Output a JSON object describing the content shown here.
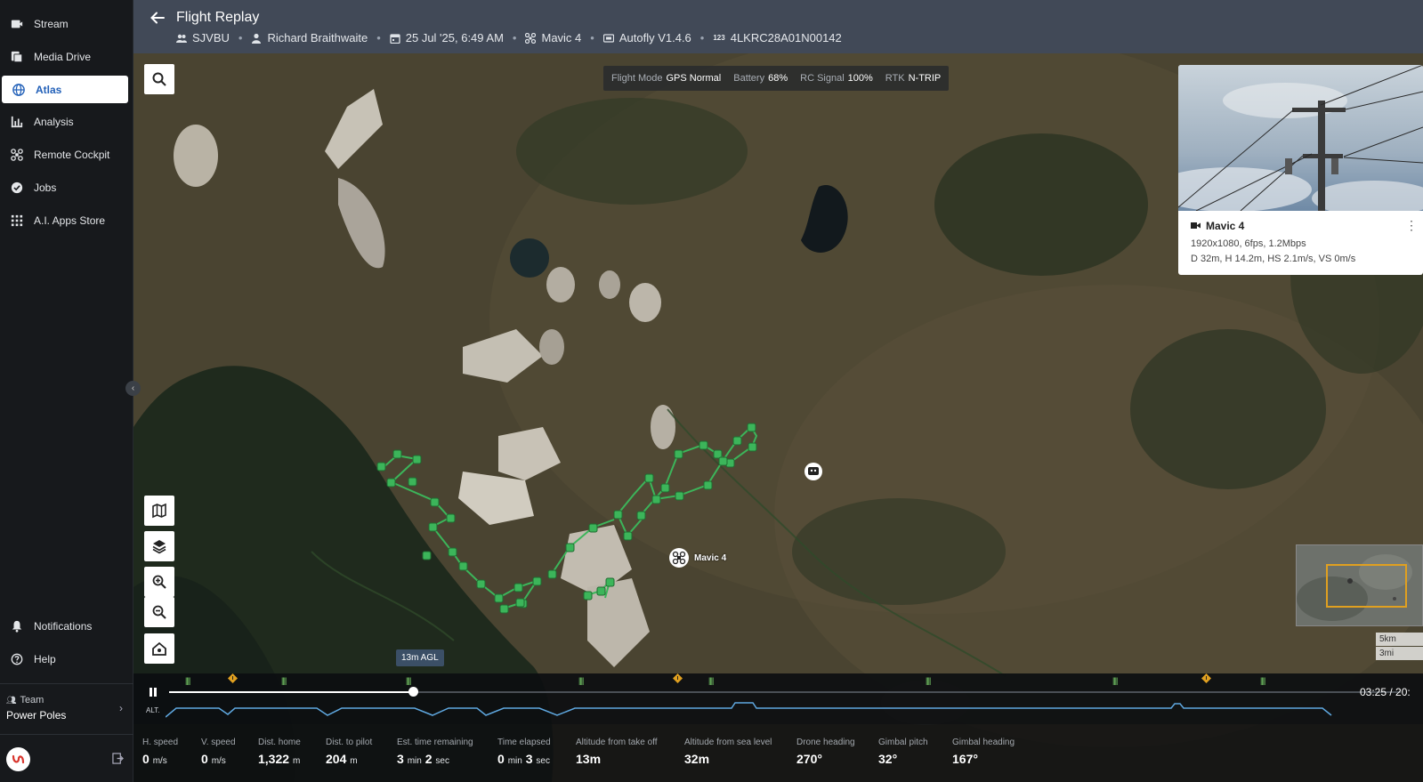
{
  "sidebar": {
    "items": [
      {
        "label": "Stream",
        "icon": "camera-icon"
      },
      {
        "label": "Media Drive",
        "icon": "media-icon"
      },
      {
        "label": "Atlas",
        "icon": "globe-icon",
        "active": true
      },
      {
        "label": "Analysis",
        "icon": "bar-chart-icon"
      },
      {
        "label": "Remote Cockpit",
        "icon": "drone-icon"
      },
      {
        "label": "Jobs",
        "icon": "check-circle-icon"
      },
      {
        "label": "A.I. Apps Store",
        "icon": "grid-icon"
      }
    ],
    "bottom_items": [
      {
        "label": "Notifications",
        "icon": "bell-icon"
      },
      {
        "label": "Help",
        "icon": "help-icon"
      }
    ],
    "team": {
      "label": "Team",
      "name": "Power Poles"
    },
    "active_color": "#2260b8"
  },
  "header": {
    "title": "Flight Replay",
    "group": "SJVBU",
    "pilot": "Richard Braithwaite",
    "date": "25 Jul '25, 6:49 AM",
    "drone": "Mavic 4",
    "software": "Autofly V1.4.6",
    "serial": "4LKRC28A01N00142"
  },
  "status": {
    "flight_mode_label": "Flight Mode",
    "flight_mode": "GPS Normal",
    "battery_label": "Battery",
    "battery": "68%",
    "rc_label": "RC Signal",
    "rc": "100%",
    "rtk_label": "RTK",
    "rtk": "N-TRIP"
  },
  "map": {
    "drone_label": "Mavic 4",
    "agl": "13m AGL",
    "scale_km": "5km",
    "scale_mi": "3mi",
    "path_color": "#3cb55a"
  },
  "video": {
    "camera": "Mavic 4",
    "spec": "1920x1080, 6fps, 1.2Mbps",
    "telemetry": "D 32m, H 14.2m, HS 2.1m/s, VS 0m/s"
  },
  "timeline": {
    "time": "03:25 / 20:",
    "alt_label": "ALT.",
    "progress": 0.198
  },
  "telemetry": [
    {
      "label": "H. speed",
      "value": "0",
      "unit": "m/s"
    },
    {
      "label": "V. speed",
      "value": "0",
      "unit": "m/s"
    },
    {
      "label": "Dist. home",
      "value": "1,322",
      "unit": "m"
    },
    {
      "label": "Dist. to pilot",
      "value": "204",
      "unit": "m"
    },
    {
      "label": "Est. time remaining",
      "value": "3",
      "unit": "min",
      "value2": "2",
      "unit2": "sec"
    },
    {
      "label": "Time elapsed",
      "value": "0",
      "unit": "min",
      "value2": "3",
      "unit2": "sec"
    },
    {
      "label": "Altitude from take off",
      "value": "13m",
      "unit": ""
    },
    {
      "label": "Altitude from sea level",
      "value": "32m",
      "unit": ""
    },
    {
      "label": "Drone heading",
      "value": "270°",
      "unit": ""
    },
    {
      "label": "Gimbal pitch",
      "value": "32°",
      "unit": ""
    },
    {
      "label": "Gimbal heading",
      "value": "167°",
      "unit": ""
    }
  ]
}
